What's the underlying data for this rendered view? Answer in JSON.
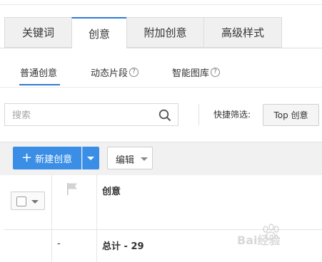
{
  "main_tabs": [
    {
      "label": "关键词",
      "active": false
    },
    {
      "label": "创意",
      "active": true
    },
    {
      "label": "附加创意",
      "active": false
    },
    {
      "label": "高级样式",
      "active": false
    }
  ],
  "sub_tabs": [
    {
      "label": "普通创意",
      "active": true,
      "help_icon": false
    },
    {
      "label": "动态片段",
      "active": false,
      "help_icon": true
    },
    {
      "label": "智能图库",
      "active": false,
      "help_icon": true
    }
  ],
  "search": {
    "placeholder": "搜索",
    "value": "",
    "icon": "search-icon"
  },
  "quick_filter": {
    "label": "快捷筛选:",
    "button_label": "Top 创意"
  },
  "toolbar": {
    "new_label": "新建创意",
    "new_icon": "plus-icon",
    "edit_label": "编辑"
  },
  "table": {
    "columns": [
      {
        "name": "select",
        "icon": "checkbox-dropdown"
      },
      {
        "name": "flag",
        "icon": "flag-icon"
      },
      {
        "name": "title",
        "label": "创意"
      }
    ],
    "rows": [
      {
        "flag": "-",
        "title": "总计 - 29"
      }
    ]
  },
  "help_glyph": "?",
  "watermark": {
    "text": "Bai经验"
  },
  "colors": {
    "accent": "#2e7bd6",
    "primary_button": "#3a8ee6",
    "toolbar_bg": "#f1f1f1",
    "tab_bg": "#f0f0f0"
  }
}
